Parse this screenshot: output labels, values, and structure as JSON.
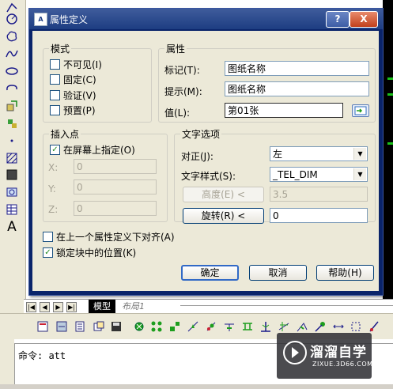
{
  "dialog": {
    "title": "属性定义",
    "help_label": "?",
    "close_label": "X",
    "mode": {
      "legend": "模式",
      "invisible": {
        "label": "不可见(I)",
        "checked": false
      },
      "constant": {
        "label": "固定(C)",
        "checked": false
      },
      "verify": {
        "label": "验证(V)",
        "checked": false
      },
      "preset": {
        "label": "预置(P)",
        "checked": false
      }
    },
    "attribute": {
      "legend": "属性",
      "tag_label": "标记(T):",
      "tag_value": "图纸名称",
      "prompt_label": "提示(M):",
      "prompt_value": "图纸名称",
      "value_label": "值(L):",
      "value_value": "第01张"
    },
    "insertion": {
      "legend": "插入点",
      "specify_onscreen": {
        "label": "在屏幕上指定(O)",
        "checked": true
      },
      "x_label": "X:",
      "x_value": "0",
      "y_label": "Y:",
      "y_value": "0",
      "z_label": "Z:",
      "z_value": "0"
    },
    "text_options": {
      "legend": "文字选项",
      "justify_label": "对正(J):",
      "justify_value": "左",
      "style_label": "文字样式(S):",
      "style_value": "_TEL_DIM",
      "height_button": "高度(E) <",
      "height_value": "3.5",
      "rotation_button": "旋转(R) <",
      "rotation_value": "0"
    },
    "align_below": {
      "label": "在上一个属性定义下对齐(A)",
      "checked": false
    },
    "lock_position": {
      "label": "锁定块中的位置(K)",
      "checked": true
    },
    "ok_label": "确定",
    "cancel_label": "取消",
    "help_button_label": "帮助(H)"
  },
  "app": {
    "tab_model": "模型",
    "tab_layout": "布局1",
    "command_text": "命令: att"
  },
  "watermark": {
    "title": "溜溜自学",
    "subtitle": "ZIXUE.3D66.COM"
  }
}
